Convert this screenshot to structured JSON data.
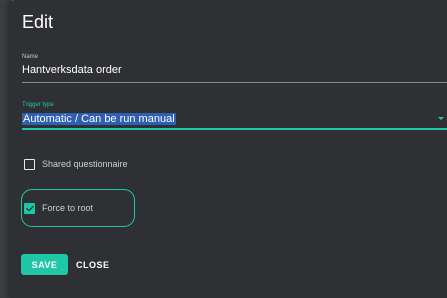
{
  "dialog": {
    "title": "Edit",
    "name_field": {
      "label": "Name",
      "value": "Hantverksdata order"
    },
    "trigger_field": {
      "label": "Trigger type",
      "value": "Automatic / Can be run manual"
    },
    "shared_questionnaire": {
      "label": "Shared questionnaire",
      "checked": false
    },
    "force_to_root": {
      "label": "Force to root",
      "checked": true
    },
    "buttons": {
      "save_label": "SAVE",
      "close_label": "CLOSE"
    }
  },
  "colors": {
    "accent": "#1ec7a6",
    "dialog_bg": "#2f3034",
    "selection": "#2f5fb3"
  }
}
